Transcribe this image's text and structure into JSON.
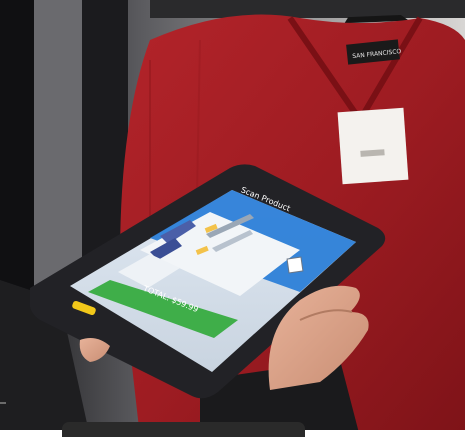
{
  "tablet": {
    "app_title": "Scan Product",
    "total_label": "TOTAL: $59.99"
  },
  "garment": {
    "brand_label": "SAN FRANCISCO"
  }
}
